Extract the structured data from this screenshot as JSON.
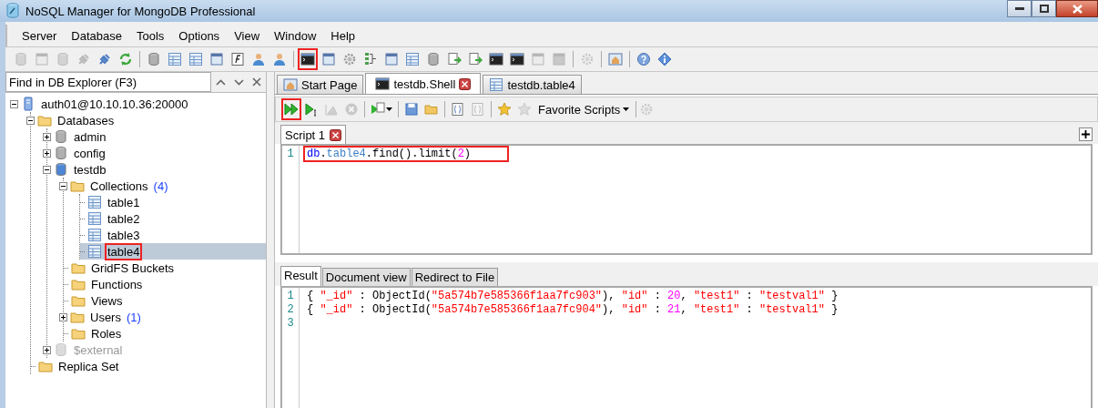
{
  "window": {
    "title": "NoSQL Manager for MongoDB Professional"
  },
  "menu": [
    "Server",
    "Database",
    "Tools",
    "Options",
    "View",
    "Window",
    "Help"
  ],
  "toolbar": [
    {
      "disabled": true,
      "highlighted": false
    },
    {
      "disabled": true,
      "highlighted": false
    },
    {
      "disabled": true,
      "highlighted": false
    },
    {
      "disabled": true,
      "highlighted": false
    },
    {
      "disabled": false,
      "highlighted": false
    },
    {
      "disabled": false,
      "highlighted": false
    },
    {
      "disabled": false,
      "highlighted": false
    },
    {
      "disabled": false,
      "highlighted": false
    },
    {
      "disabled": false,
      "highlighted": false
    },
    {
      "disabled": false,
      "highlighted": false
    },
    {
      "disabled": false,
      "highlighted": false
    },
    {
      "disabled": false,
      "highlighted": false
    },
    {
      "disabled": false,
      "highlighted": false
    },
    {
      "disabled": false,
      "highlighted": true
    },
    {
      "disabled": false,
      "highlighted": false
    },
    {
      "disabled": false,
      "highlighted": false
    },
    {
      "disabled": false,
      "highlighted": false
    },
    {
      "disabled": false,
      "highlighted": false
    },
    {
      "disabled": false,
      "highlighted": false
    },
    {
      "disabled": false,
      "highlighted": false
    },
    {
      "disabled": false,
      "highlighted": false
    },
    {
      "disabled": false,
      "highlighted": false
    },
    {
      "disabled": false,
      "highlighted": false
    },
    {
      "disabled": false,
      "highlighted": false
    },
    {
      "disabled": true,
      "highlighted": false
    },
    {
      "disabled": true,
      "highlighted": false
    },
    {
      "disabled": true,
      "highlighted": false
    },
    {
      "disabled": false,
      "highlighted": false
    },
    {
      "disabled": false,
      "highlighted": false
    },
    {
      "disabled": false,
      "highlighted": false
    }
  ],
  "explorer": {
    "search": {
      "value": "Find in DB Explorer (F3)"
    },
    "tree": [
      {
        "label": "auth01@10.10.10.36:20000",
        "kind": "server",
        "expanded": true,
        "selected": false,
        "highlighted": false,
        "muted": false,
        "children": [
          {
            "label": "Databases",
            "kind": "folder",
            "expanded": true,
            "selected": false,
            "highlighted": false,
            "muted": false,
            "children": [
              {
                "label": "admin",
                "kind": "database",
                "expanded": false,
                "selected": false,
                "highlighted": false,
                "muted": false
              },
              {
                "label": "config",
                "kind": "database",
                "expanded": false,
                "selected": false,
                "highlighted": false,
                "muted": false
              },
              {
                "label": "testdb",
                "kind": "database",
                "expanded": true,
                "selected": false,
                "highlighted": false,
                "muted": false,
                "children": [
                  {
                    "label": "Collections",
                    "count": "(4)",
                    "kind": "folder",
                    "expanded": true,
                    "selected": false,
                    "highlighted": false,
                    "muted": false,
                    "children": [
                      {
                        "label": "table1",
                        "kind": "collection",
                        "selected": false,
                        "highlighted": false,
                        "muted": false
                      },
                      {
                        "label": "table2",
                        "kind": "collection",
                        "selected": false,
                        "highlighted": false,
                        "muted": false
                      },
                      {
                        "label": "table3",
                        "kind": "collection",
                        "selected": false,
                        "highlighted": false,
                        "muted": false
                      },
                      {
                        "label": "table4",
                        "kind": "collection",
                        "selected": true,
                        "highlighted": true,
                        "muted": false
                      }
                    ]
                  },
                  {
                    "label": "GridFS Buckets",
                    "kind": "folder",
                    "selected": false,
                    "highlighted": false,
                    "muted": false
                  },
                  {
                    "label": "Functions",
                    "kind": "folder",
                    "selected": false,
                    "highlighted": false,
                    "muted": false
                  },
                  {
                    "label": "Views",
                    "kind": "folder",
                    "selected": false,
                    "highlighted": false,
                    "muted": false
                  },
                  {
                    "label": "Users",
                    "count": "(1)",
                    "kind": "folder",
                    "expanded": false,
                    "selected": false,
                    "highlighted": false,
                    "muted": false
                  },
                  {
                    "label": "Roles",
                    "kind": "folder",
                    "selected": false,
                    "highlighted": false,
                    "muted": false
                  }
                ]
              },
              {
                "label": "$external",
                "kind": "database",
                "expanded": false,
                "selected": false,
                "highlighted": false,
                "muted": true
              }
            ]
          },
          {
            "label": "Replica Set",
            "kind": "folder",
            "selected": false,
            "highlighted": false,
            "muted": false
          }
        ]
      }
    ]
  },
  "tabs": [
    {
      "label": "Start Page",
      "kind": "start",
      "selected": false
    },
    {
      "label": "testdb.Shell",
      "kind": "shell",
      "selected": true
    },
    {
      "label": "testdb.table4",
      "kind": "collection",
      "selected": false
    }
  ],
  "shell_toolbar": {
    "buttons": [
      {
        "disabled": false,
        "highlighted": true
      },
      {
        "disabled": false,
        "highlighted": false
      },
      {
        "disabled": true,
        "highlighted": false
      },
      {
        "disabled": true,
        "highlighted": false
      },
      {
        "disabled": false,
        "highlighted": false
      },
      {
        "disabled": false,
        "highlighted": false
      },
      {
        "disabled": false,
        "highlighted": false
      },
      {
        "disabled": false,
        "highlighted": false
      },
      {
        "disabled": true,
        "highlighted": false
      },
      {
        "disabled": false,
        "highlighted": false
      },
      {
        "disabled": true,
        "highlighted": false
      }
    ],
    "favorites_label": "Favorite Scripts"
  },
  "script_tabs": [
    {
      "label": "Script 1",
      "selected": true
    }
  ],
  "editor": {
    "lines": [
      {
        "number": "1",
        "highlighted": true,
        "tokens": [
          {
            "text": "db",
            "kind": "keyword"
          },
          {
            "text": ".",
            "kind": "plain"
          },
          {
            "text": "table4",
            "kind": "property"
          },
          {
            "text": ".find().limit(",
            "kind": "plain"
          },
          {
            "text": "2",
            "kind": "number"
          },
          {
            "text": ")",
            "kind": "plain"
          }
        ]
      }
    ]
  },
  "result_tabs": [
    {
      "label": "Result",
      "selected": true
    },
    {
      "label": "Document view",
      "selected": false
    },
    {
      "label": "Redirect to File",
      "selected": false
    }
  ],
  "result": {
    "lines": [
      {
        "number": "1",
        "tokens": [
          {
            "text": "{ ",
            "kind": "plain"
          },
          {
            "text": "\"_id\"",
            "kind": "string"
          },
          {
            "text": " : ObjectId(",
            "kind": "plain"
          },
          {
            "text": "\"5a574b7e585366f1aa7fc903\"",
            "kind": "string"
          },
          {
            "text": "), ",
            "kind": "plain"
          },
          {
            "text": "\"id\"",
            "kind": "string"
          },
          {
            "text": " : ",
            "kind": "plain"
          },
          {
            "text": "20",
            "kind": "number"
          },
          {
            "text": ", ",
            "kind": "plain"
          },
          {
            "text": "\"test1\"",
            "kind": "string"
          },
          {
            "text": " : ",
            "kind": "plain"
          },
          {
            "text": "\"testval1\"",
            "kind": "string"
          },
          {
            "text": " }",
            "kind": "plain"
          }
        ]
      },
      {
        "number": "2",
        "tokens": [
          {
            "text": "{ ",
            "kind": "plain"
          },
          {
            "text": "\"_id\"",
            "kind": "string"
          },
          {
            "text": " : ObjectId(",
            "kind": "plain"
          },
          {
            "text": "\"5a574b7e585366f1aa7fc904\"",
            "kind": "string"
          },
          {
            "text": "), ",
            "kind": "plain"
          },
          {
            "text": "\"id\"",
            "kind": "string"
          },
          {
            "text": " : ",
            "kind": "plain"
          },
          {
            "text": "21",
            "kind": "number"
          },
          {
            "text": ", ",
            "kind": "plain"
          },
          {
            "text": "\"test1\"",
            "kind": "string"
          },
          {
            "text": " : ",
            "kind": "plain"
          },
          {
            "text": "\"testval1\"",
            "kind": "string"
          },
          {
            "text": " }",
            "kind": "plain"
          }
        ]
      },
      {
        "number": "3"
      }
    ]
  }
}
